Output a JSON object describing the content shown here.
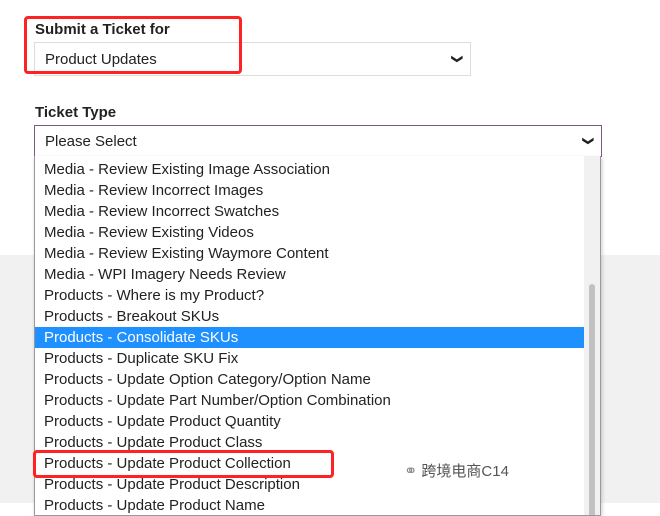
{
  "submit_for": {
    "label": "Submit a Ticket for",
    "value": "Product Updates"
  },
  "ticket_type": {
    "label": "Ticket Type",
    "value": "Please Select",
    "options": [
      "Media - Review Existing Image Association",
      "Media - Review Incorrect Images",
      "Media - Review Incorrect Swatches",
      "Media - Review Existing Videos",
      "Media - Review Existing Waymore Content",
      "Media - WPI Imagery Needs Review",
      "Products - Where is my Product?",
      "Products - Breakout SKUs",
      "Products - Consolidate SKUs",
      "Products - Duplicate SKU Fix",
      "Products - Update Option Category/Option Name",
      "Products - Update Part Number/Option Combination",
      "Products - Update Product Quantity",
      "Products - Update Product Class",
      "Products - Update Product Collection",
      "Products - Update Product Description",
      "Products - Update Product Name"
    ],
    "highlighted_index": 8
  },
  "watermark": "跨境电商C14",
  "colors": {
    "highlight": "#1e90ff",
    "annotation": "#ff2222"
  }
}
